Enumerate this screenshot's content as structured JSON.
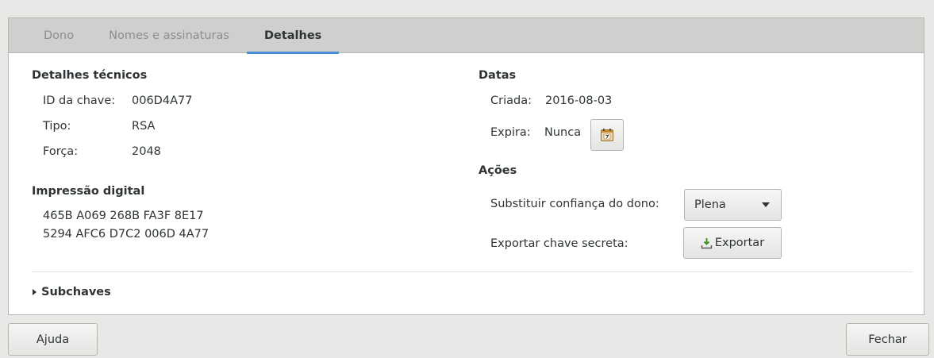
{
  "tabs": [
    {
      "label": "Dono"
    },
    {
      "label": "Nomes e assinaturas"
    },
    {
      "label": "Detalhes"
    }
  ],
  "technical": {
    "heading": "Detalhes técnicos",
    "key_id_label": "ID da chave:",
    "key_id_value": "006D4A77",
    "type_label": "Tipo:",
    "type_value": "RSA",
    "strength_label": "Força:",
    "strength_value": "2048"
  },
  "fingerprint": {
    "heading": "Impressão digital",
    "line1": "465B A069 268B FA3F 8E17",
    "line2": "5294 AFC6 D7C2 006D 4A77"
  },
  "dates": {
    "heading": "Datas",
    "created_label": "Criada:",
    "created_value": "2016-08-03",
    "expires_label": "Expira:",
    "expires_value": "Nunca",
    "calendar_icon": "calendar-icon"
  },
  "actions": {
    "heading": "Ações",
    "trust_label": "Substituir confiança do dono:",
    "trust_value": "Plena",
    "export_label": "Exportar chave secreta:",
    "export_button": "Exportar",
    "export_icon": "export-icon"
  },
  "subkeys": {
    "label": "Subchaves"
  },
  "footer": {
    "help_button": "Ajuda",
    "close_button": "Fechar"
  },
  "colors": {
    "accent": "#4a90d9",
    "tabbar_bg": "#cfcfcd",
    "window_bg": "#e8e8e7"
  }
}
